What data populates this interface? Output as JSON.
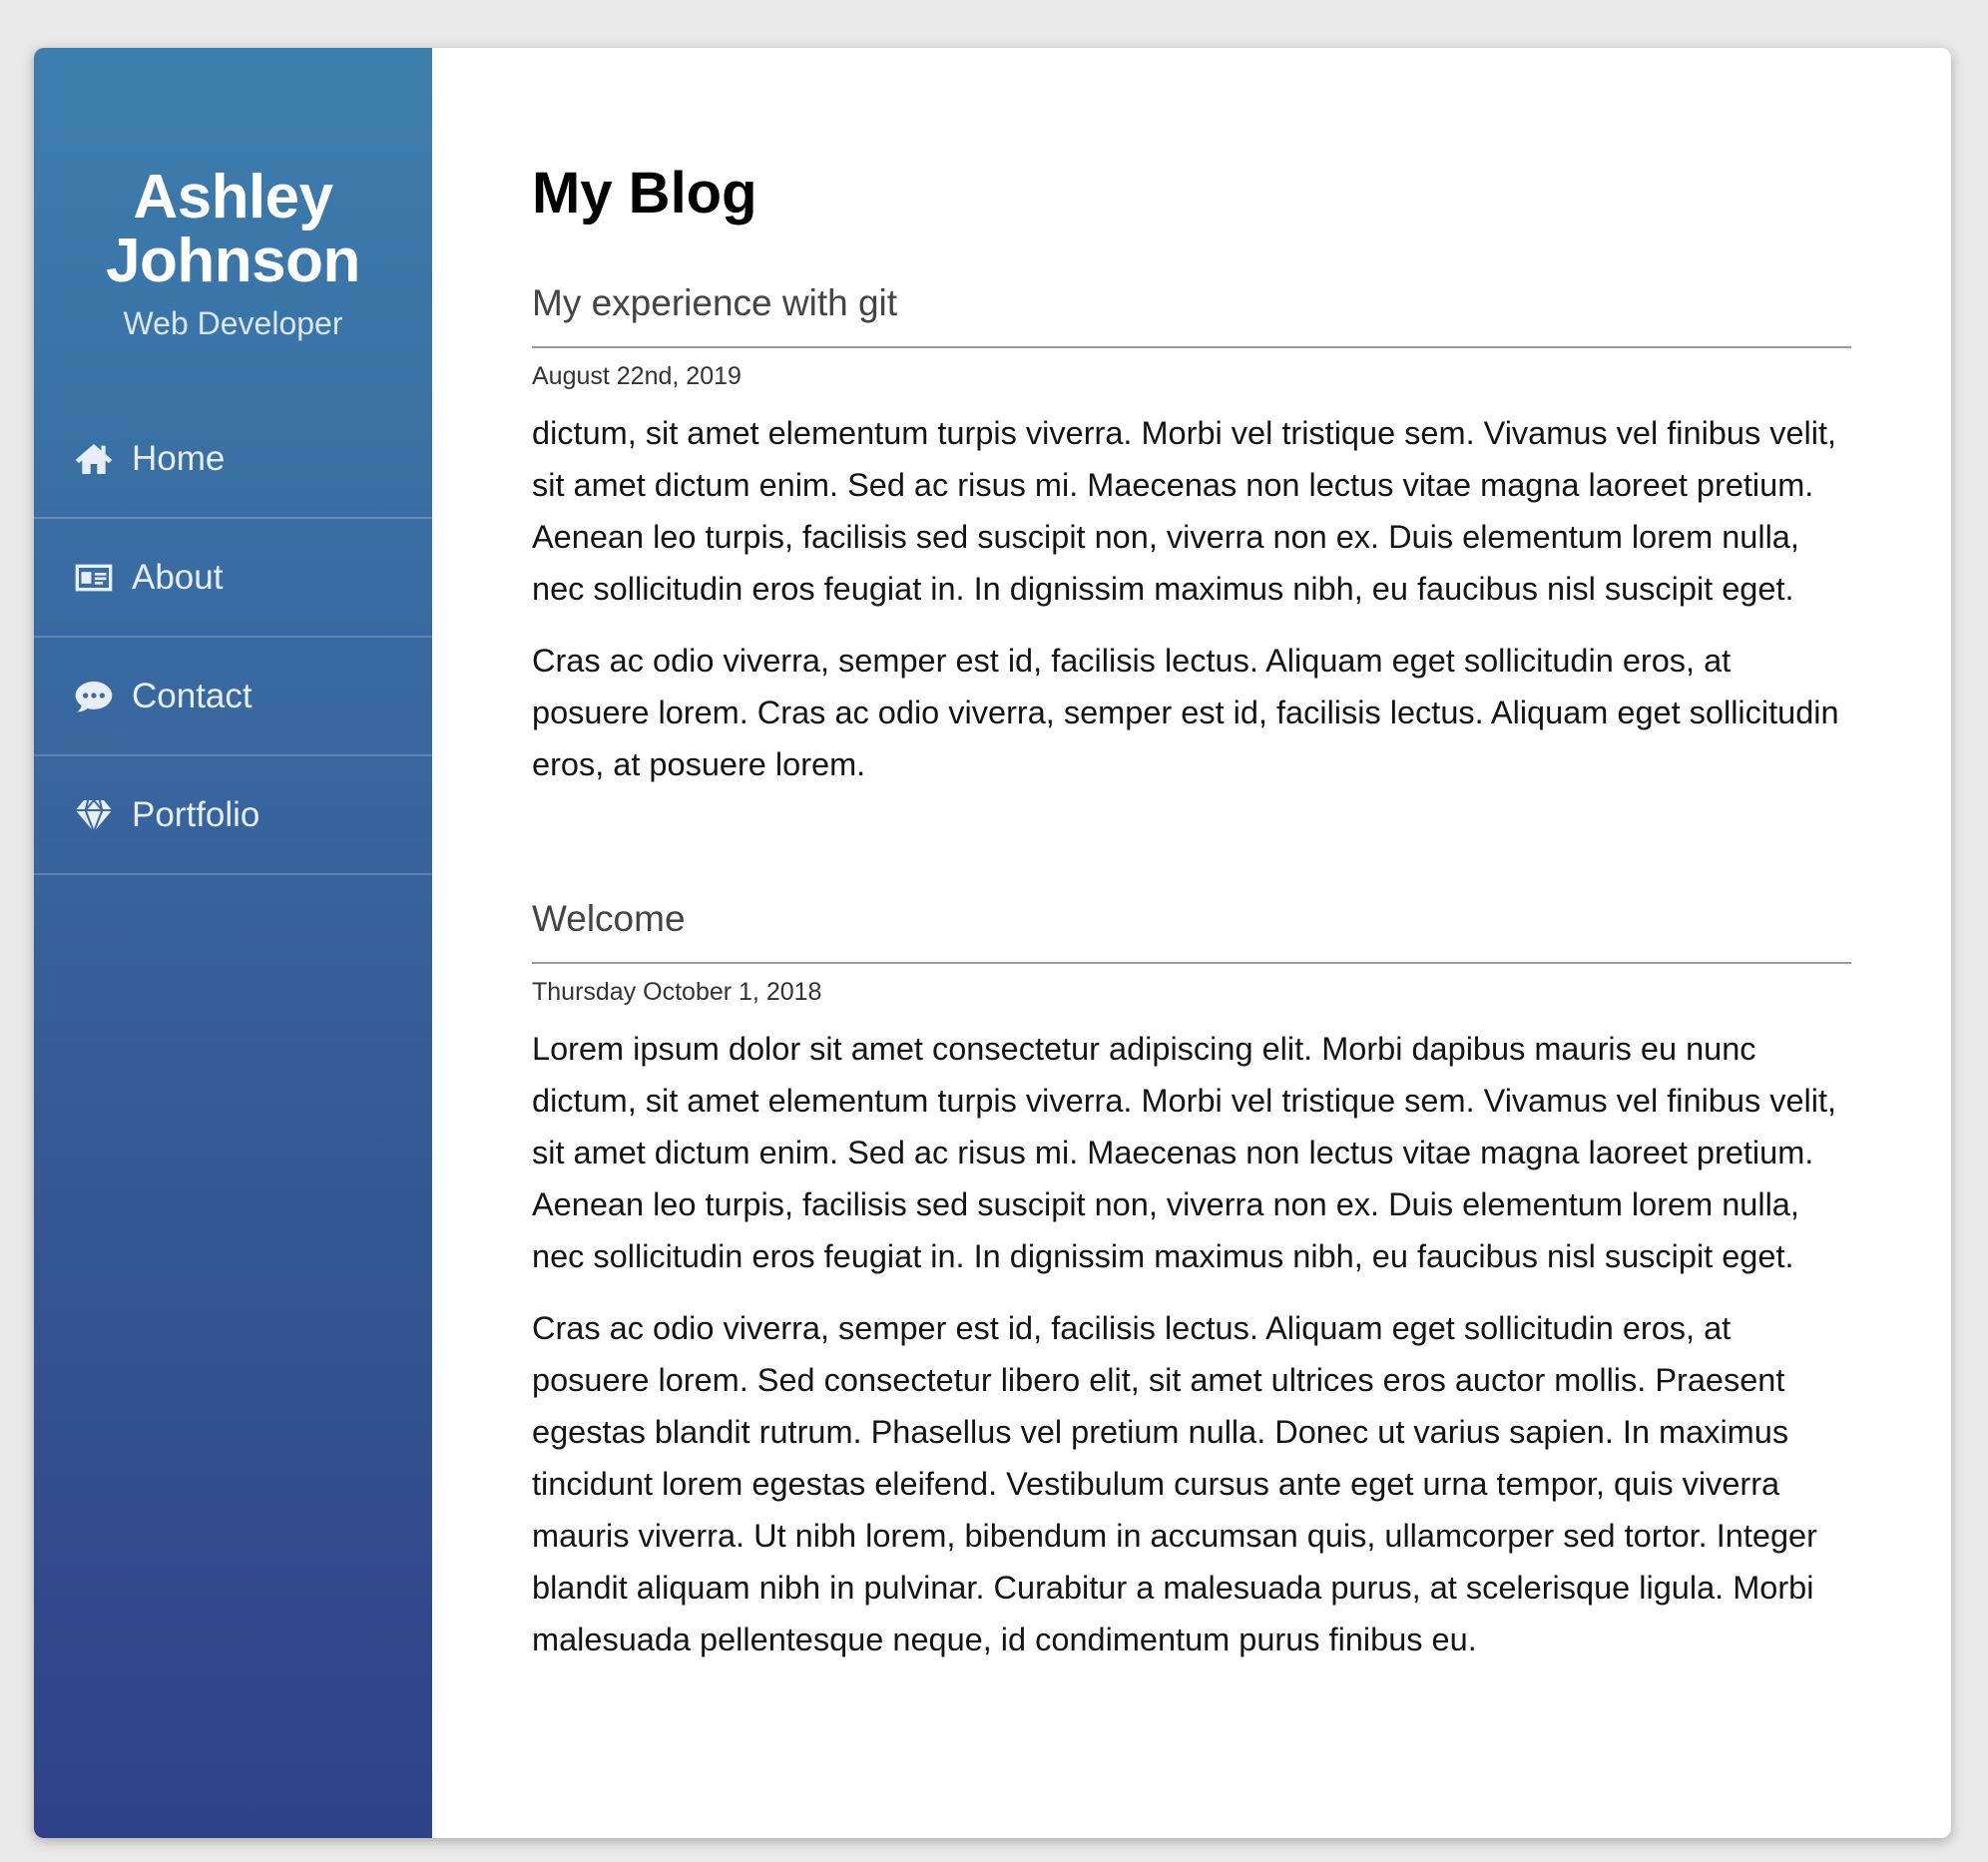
{
  "sidebar": {
    "name": "Ashley\nJohnson",
    "role": "Web Developer",
    "nav": [
      {
        "label": "Home",
        "icon": "home-icon"
      },
      {
        "label": "About",
        "icon": "id-card-icon"
      },
      {
        "label": "Contact",
        "icon": "chat-bubble-icon"
      },
      {
        "label": "Portfolio",
        "icon": "diamond-icon"
      }
    ]
  },
  "main": {
    "title": "My Blog",
    "posts": [
      {
        "title": "My experience with git",
        "date": "August 22nd, 2019",
        "paragraphs": [
          "dictum, sit amet elementum turpis viverra. Morbi vel tristique sem. Vivamus vel finibus velit, sit amet dictum enim. Sed ac risus mi. Maecenas non lectus vitae magna laoreet pretium. Aenean leo turpis, facilisis sed suscipit non, viverra non ex. Duis elementum lorem nulla, nec sollicitudin eros feugiat in. In dignissim maximus nibh, eu faucibus nisl suscipit eget.",
          "Cras ac odio viverra, semper est id, facilisis lectus. Aliquam eget sollicitudin eros, at posuere lorem. Cras ac odio viverra, semper est id, facilisis lectus. Aliquam eget sollicitudin eros, at posuere lorem."
        ]
      },
      {
        "title": "Welcome",
        "date": "Thursday October 1, 2018",
        "paragraphs": [
          "Lorem ipsum dolor sit amet consectetur adipiscing elit. Morbi dapibus mauris eu nunc dictum, sit amet elementum turpis viverra. Morbi vel tristique sem. Vivamus vel finibus velit, sit amet dictum enim. Sed ac risus mi. Maecenas non lectus vitae magna laoreet pretium. Aenean leo turpis, facilisis sed suscipit non, viverra non ex. Duis elementum lorem nulla, nec sollicitudin eros feugiat in. In dignissim maximus nibh, eu faucibus nisl suscipit eget.",
          "Cras ac odio viverra, semper est id, facilisis lectus. Aliquam eget sollicitudin eros, at posuere lorem. Sed consectetur libero elit, sit amet ultrices eros auctor mollis. Praesent egestas blandit rutrum. Phasellus vel pretium nulla. Donec ut varius sapien. In maximus tincidunt lorem egestas eleifend. Vestibulum cursus ante eget urna tempor, quis viverra mauris viverra. Ut nibh lorem, bibendum in accumsan quis, ullamcorper sed tortor. Integer blandit aliquam nibh in pulvinar. Curabitur a malesuada purus, at scelerisque ligula. Morbi malesuada pellentesque neque, id condimentum purus finibus eu."
        ]
      }
    ]
  }
}
